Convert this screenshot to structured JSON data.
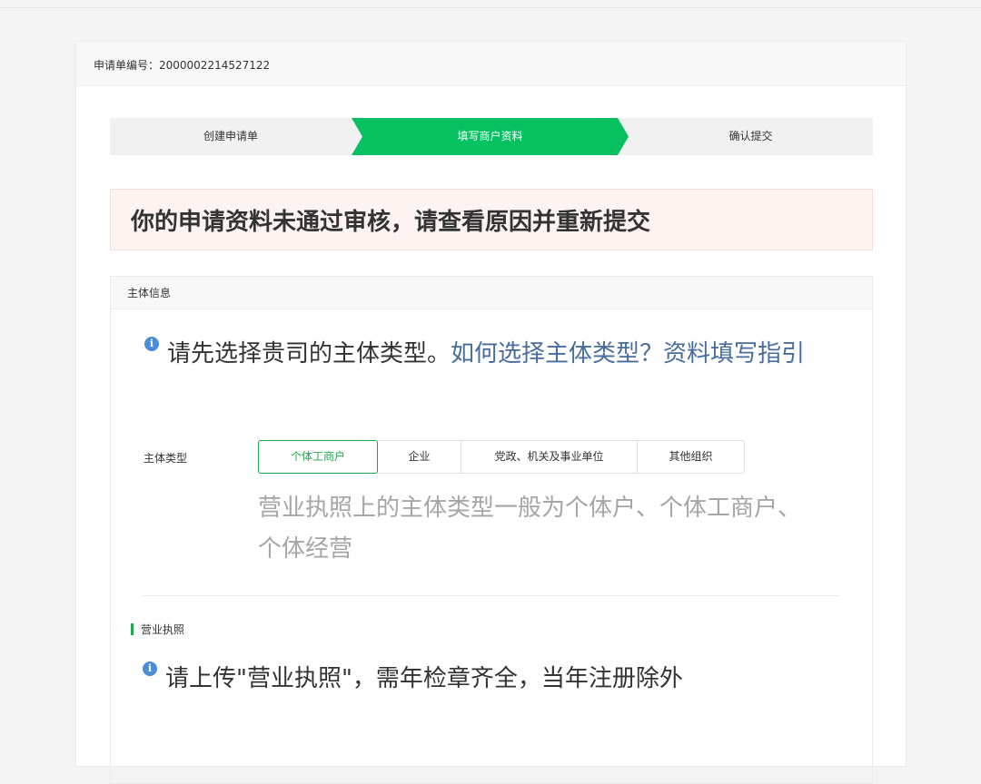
{
  "header": {
    "application_no": "申请单编号：2000002214527122"
  },
  "steps": [
    {
      "label": "创建申请单",
      "state": "done"
    },
    {
      "label": "填写商户资料",
      "state": "active"
    },
    {
      "label": "确认提交",
      "state": "pending"
    }
  ],
  "alert": {
    "message": "你的申请资料未通过审核，请查看原因并重新提交"
  },
  "section": {
    "title": "主体信息",
    "tip_text": "请先选择贵司的主体类型。",
    "tip_link": "如何选择主体类型？资料填写指引",
    "field_label": "主体类型",
    "types": [
      "个体工商户",
      "企业",
      "党政、机关及事业单位",
      "其他组织"
    ],
    "selected_type": "个体工商户",
    "hint": "营业执照上的主体类型一般为个体户、个体工商户、个体经营",
    "license_title": "营业执照",
    "license_tip": "请上传\"营业执照\"，需年检章齐全，当年注册除外"
  },
  "colors": {
    "accent": "#07c160",
    "selected": "#1ea64a",
    "link": "#476c9e",
    "info": "#4b8dd8",
    "alert_bg": "#fdf3f1"
  },
  "icons": [
    "info-icon"
  ]
}
